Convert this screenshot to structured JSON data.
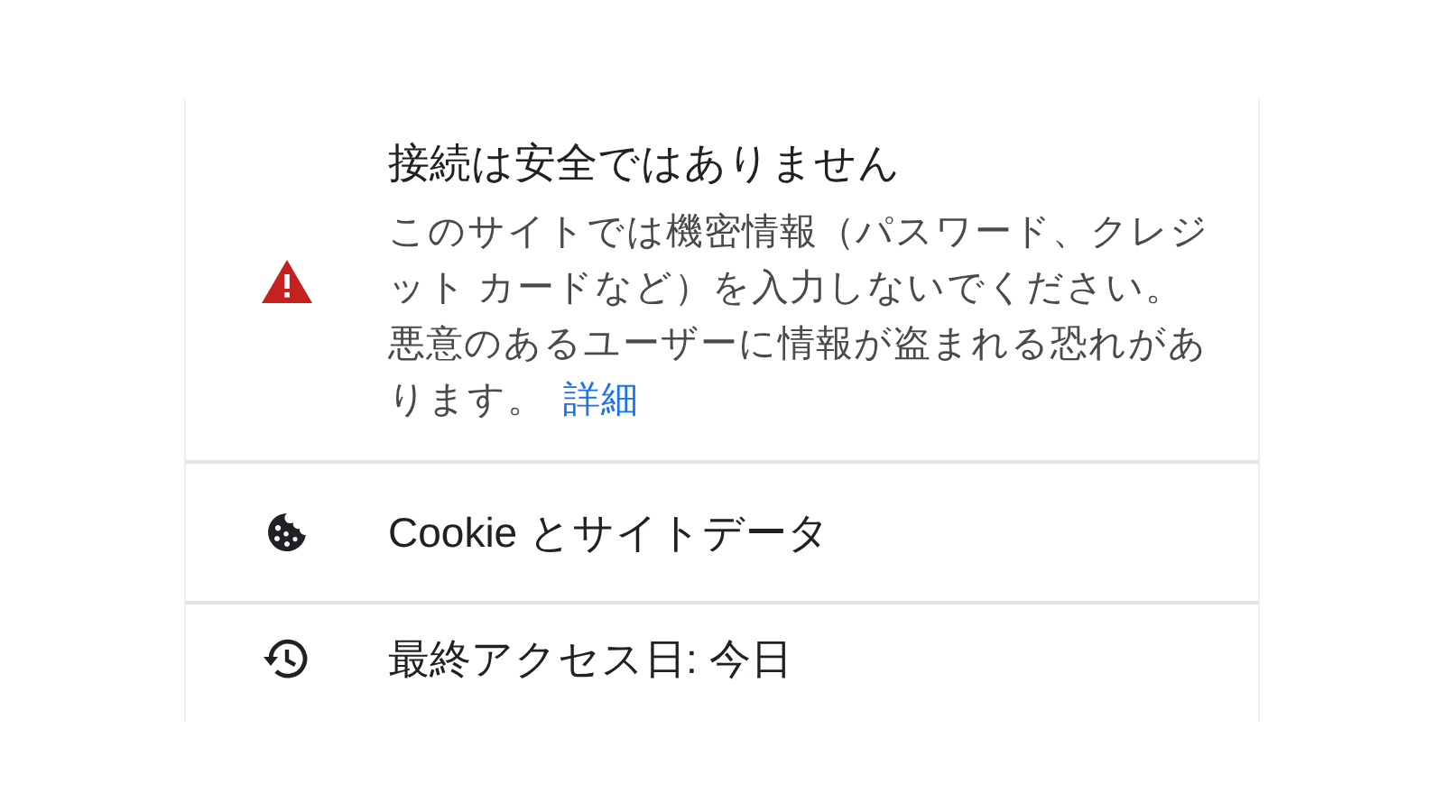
{
  "items": [
    {
      "kind": "warning",
      "title": "接続は安全ではありません",
      "paragraphs": [
        "このサイトでは機密情報（パスワード、クレジット カードなど）を入力しないでください。",
        "悪意のあるユーザーに情報が盗まれる恐れがあります。"
      ],
      "link": "詳細"
    },
    {
      "kind": "cookie",
      "label": "Cookie とサイトデータ"
    },
    {
      "kind": "history",
      "label": "最終アクセス日: 今日"
    }
  ]
}
